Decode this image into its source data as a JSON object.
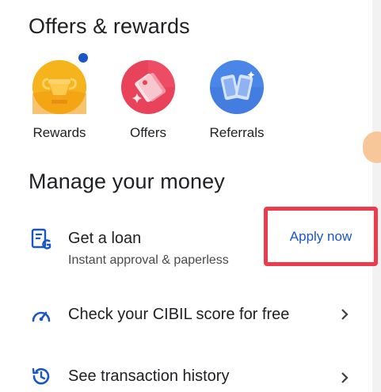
{
  "offers": {
    "title": "Offers & rewards",
    "items": [
      {
        "label": "Rewards",
        "icon": "trophy-icon",
        "color": "#f4b400"
      },
      {
        "label": "Offers",
        "icon": "tag-icon",
        "color": "#e8435a"
      },
      {
        "label": "Referrals",
        "icon": "phones-icon",
        "color": "#4a86e8"
      }
    ]
  },
  "money": {
    "title": "Manage your money",
    "loan": {
      "title": "Get a loan",
      "subtitle": "Instant approval & paperless",
      "action": "Apply now",
      "icon": "loan-document-icon"
    },
    "cibil": {
      "title": "Check your CIBIL score for free",
      "icon": "gauge-icon"
    },
    "history": {
      "title": "See transaction history",
      "icon": "history-icon"
    }
  },
  "colors": {
    "accent": "#1a56c4",
    "highlight": "#ec3b4c"
  }
}
